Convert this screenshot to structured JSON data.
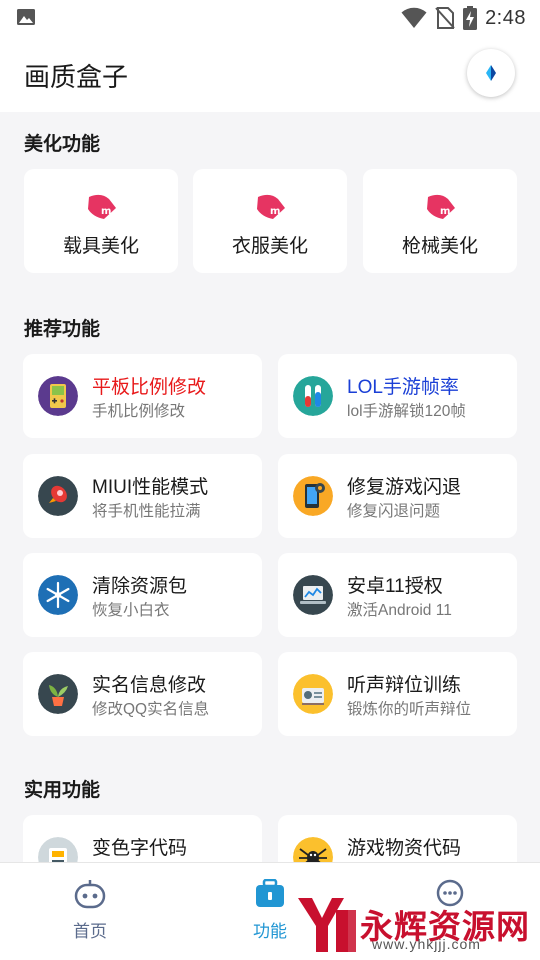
{
  "status_bar": {
    "time": "2:48"
  },
  "app_bar": {
    "title": "画质盒子"
  },
  "sections": {
    "beautify": {
      "title": "美化功能",
      "items": [
        {
          "label": "载具美化"
        },
        {
          "label": "衣服美化"
        },
        {
          "label": "枪械美化"
        }
      ]
    },
    "recommended": {
      "title": "推荐功能",
      "items": [
        {
          "title": "平板比例修改",
          "subtitle": "手机比例修改",
          "title_color": "#e8191a"
        },
        {
          "title": "LOL手游帧率",
          "subtitle": "lol手游解锁120帧",
          "title_color": "#1a3fd6"
        },
        {
          "title": "MIUI性能模式",
          "subtitle": "将手机性能拉满"
        },
        {
          "title": "修复游戏闪退",
          "subtitle": "修复闪退问题"
        },
        {
          "title": "清除资源包",
          "subtitle": "恢复小白衣"
        },
        {
          "title": "安卓11授权",
          "subtitle": "激活Android 11"
        },
        {
          "title": "实名信息修改",
          "subtitle": "修改QQ实名信息"
        },
        {
          "title": "听声辩位训练",
          "subtitle": "锻炼你的听声辩位"
        }
      ]
    },
    "utility": {
      "title": "实用功能",
      "items": [
        {
          "title": "变色字代码"
        },
        {
          "title": "游戏物资代码"
        }
      ]
    }
  },
  "bottom_nav": {
    "items": [
      {
        "label": "首页",
        "active": false
      },
      {
        "label": "功能",
        "active": true
      }
    ]
  },
  "watermark": {
    "text": "永辉资源网",
    "url": "www.yhkjjj.com"
  },
  "colors": {
    "accent": "#2196d3",
    "beauty_icon": "#e63462",
    "nav_inactive": "#5b6b8c"
  }
}
